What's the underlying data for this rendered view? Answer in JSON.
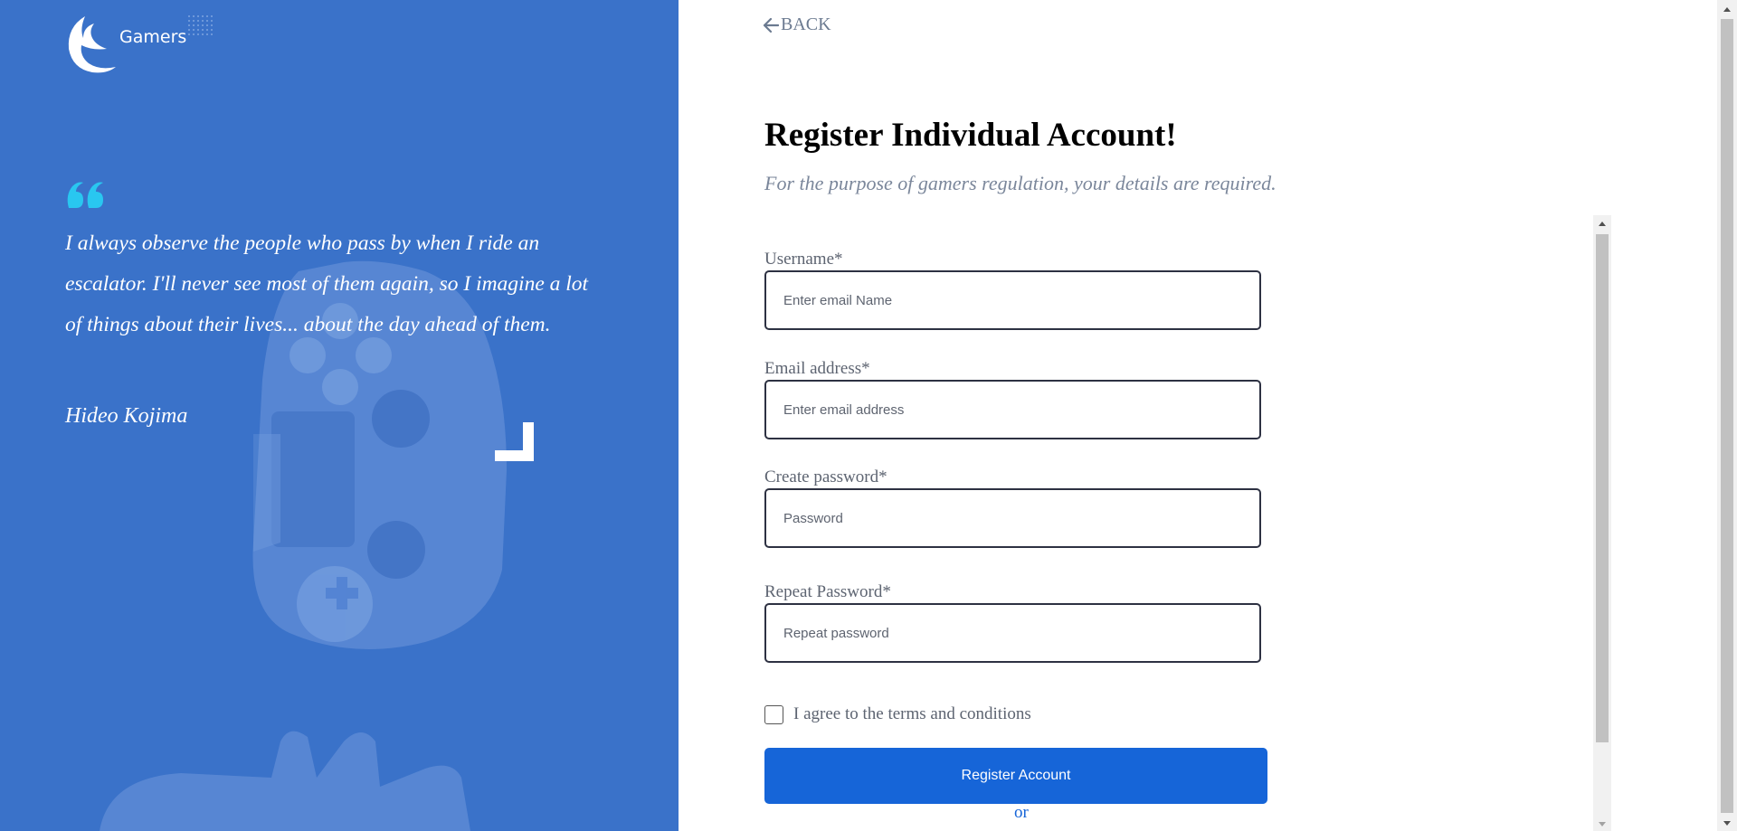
{
  "brand": {
    "name": "Gamers"
  },
  "quote": {
    "text": "I always observe the people who pass by when I ride an escalator. I'll never see most of them again, so I imagine a lot of things about their lives... about the day ahead of them.",
    "author": "Hideo Kojima"
  },
  "nav": {
    "back_label": "BACK"
  },
  "header": {
    "title": "Register Individual Account!",
    "subtitle": "For the purpose of gamers regulation, your details are required."
  },
  "form": {
    "fields": [
      {
        "label": "Username*",
        "placeholder": "Enter email Name"
      },
      {
        "label": "Email address*",
        "placeholder": "Enter email address"
      },
      {
        "label": "Create password*",
        "placeholder": "Password"
      },
      {
        "label": "Repeat Password*",
        "placeholder": "Repeat password"
      }
    ],
    "agree_label": "I agree to the terms and conditions",
    "agree_checked": false,
    "submit_label": "Register Account",
    "or_label": "or"
  },
  "colors": {
    "panel_blue": "#3a72c9",
    "accent_blue": "#1665d8",
    "quote_accent": "#29c7f0"
  }
}
